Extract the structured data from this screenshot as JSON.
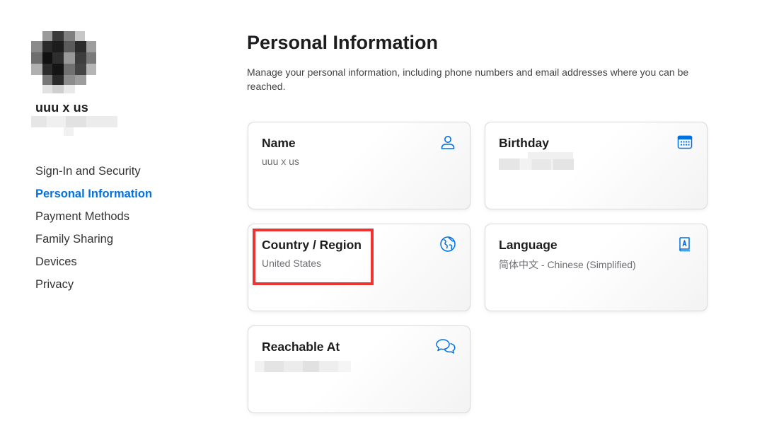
{
  "sidebar": {
    "user_name": "uuu x us",
    "nav": [
      {
        "label": "Sign-In and Security",
        "active": false
      },
      {
        "label": "Personal Information",
        "active": true
      },
      {
        "label": "Payment Methods",
        "active": false
      },
      {
        "label": "Family Sharing",
        "active": false
      },
      {
        "label": "Devices",
        "active": false
      },
      {
        "label": "Privacy",
        "active": false
      }
    ]
  },
  "main": {
    "title": "Personal Information",
    "description": "Manage your personal information, including phone numbers and email addresses where you can be reached.",
    "cards": {
      "name": {
        "title": "Name",
        "value": "uuu x us",
        "icon": "person-icon"
      },
      "birthday": {
        "title": "Birthday",
        "value": "",
        "icon": "calendar-icon"
      },
      "country": {
        "title": "Country / Region",
        "value": "United States",
        "icon": "globe-icon"
      },
      "language": {
        "title": "Language",
        "value": "简体中文 - Chinese (Simplified)",
        "icon": "dictionary-icon"
      },
      "reachable": {
        "title": "Reachable At",
        "value": "",
        "icon": "chat-bubbles-icon"
      }
    }
  },
  "colors": {
    "accent": "#0071e3",
    "highlight": "#ee3333"
  }
}
